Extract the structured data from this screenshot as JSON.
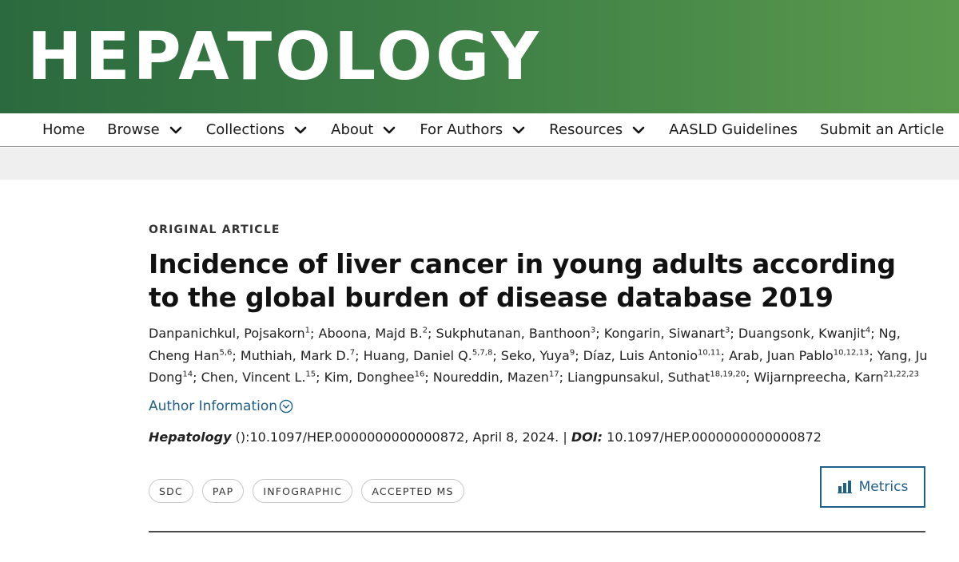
{
  "header": {
    "logo_text": "HEPATOLOGY",
    "gradient_colors": [
      "#2b6a3e",
      "#5a9a4e"
    ]
  },
  "nav": {
    "items": [
      {
        "label": "Home"
      },
      {
        "label": "Browse"
      },
      {
        "label": "Collections"
      },
      {
        "label": "About"
      },
      {
        "label": "For Authors"
      },
      {
        "label": "Resources"
      },
      {
        "label": "AASLD Guidelines"
      },
      {
        "label": "Submit an Article"
      }
    ]
  },
  "article": {
    "kicker": "ORIGINAL ARTICLE",
    "title": "Incidence of liver cancer in young adults according to the global burden of disease database 2019",
    "authors": [
      {
        "name": "Danpanichkul, Pojsakorn",
        "sup": "1"
      },
      {
        "name": "Aboona, Majd B.",
        "sup": "2"
      },
      {
        "name": "Sukphutanan, Banthoon",
        "sup": "3"
      },
      {
        "name": "Kongarin, Siwanart",
        "sup": "3"
      },
      {
        "name": "Duangsonk, Kwanjit",
        "sup": "4"
      },
      {
        "name": "Ng, Cheng Han",
        "sup": "5,6"
      },
      {
        "name": "Muthiah, Mark D.",
        "sup": "7"
      },
      {
        "name": "Huang, Daniel Q.",
        "sup": "5,7,8"
      },
      {
        "name": "Seko, Yuya",
        "sup": "9"
      },
      {
        "name": "Díaz, Luis Antonio",
        "sup": "10,11"
      },
      {
        "name": "Arab, Juan Pablo",
        "sup": "10,12,13"
      },
      {
        "name": "Yang, Ju Dong",
        "sup": "14"
      },
      {
        "name": "Chen, Vincent L.",
        "sup": "15"
      },
      {
        "name": "Kim, Donghee",
        "sup": "16"
      },
      {
        "name": "Noureddin, Mazen",
        "sup": "17"
      },
      {
        "name": "Liangpunsakul, Suthat",
        "sup": "18,19,20"
      },
      {
        "name": "Wijarnpreecha, Karn",
        "sup": "21,22,23"
      }
    ],
    "author_info_label": "Author Information",
    "citation": {
      "journal": "Hepatology",
      "text": " ():10.1097/HEP.0000000000000872, April 8, 2024.",
      "separator": " | ",
      "doi_label": "DOI:",
      "doi_value": " 10.1097/HEP.0000000000000872"
    },
    "pills": [
      "SDC",
      "PAP",
      "INFOGRAPHIC",
      "ACCEPTED MS"
    ],
    "metrics_label": "Metrics",
    "accent_color": "#1f5f8a"
  }
}
